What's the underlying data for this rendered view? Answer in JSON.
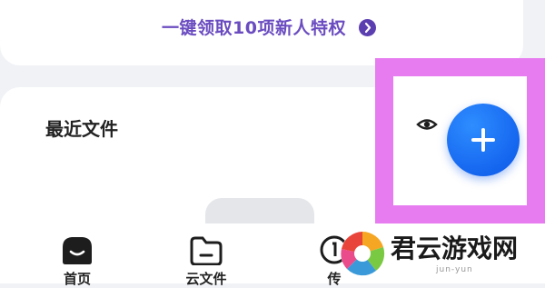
{
  "promo": {
    "text": "一键领取10项新人特权"
  },
  "recent": {
    "title": "最近文件"
  },
  "nav": {
    "home": "首页",
    "files": "云文件",
    "transfer": "传"
  },
  "watermark": {
    "name": "君云游戏网",
    "sub": "jun-yun"
  },
  "colors": {
    "accent": "#0a55e8",
    "promo_text": "#6a4cc0",
    "highlight": "#e67cf0"
  },
  "icons": {
    "promo": "arrow-right-circle-icon",
    "eye": "eye-icon",
    "fab": "plus-icon",
    "home": "home-icon",
    "files": "folder-icon",
    "transfer": "transfer-icon",
    "logo": "watermark-logo"
  }
}
